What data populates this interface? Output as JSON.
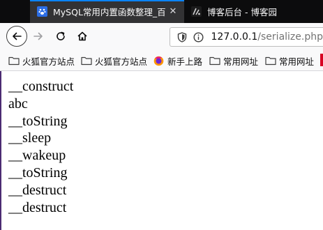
{
  "tabs": [
    {
      "title": "MySQL常用内置函数整理_百度",
      "favicon": "baidu-paw-icon",
      "active": true
    },
    {
      "title": "博客后台 - 博客园",
      "favicon": "cnblogs-icon",
      "active": false
    }
  ],
  "toolbar": {
    "back": "back-arrow-icon",
    "forward": "forward-arrow-icon",
    "reload": "reload-icon",
    "home": "home-icon"
  },
  "url": {
    "host": "127.0.0.1",
    "path": "/serialize.php"
  },
  "bookmarks": [
    {
      "label": "火狐官方站点",
      "icon": "folder-icon"
    },
    {
      "label": "火狐官方站点",
      "icon": "folder-icon"
    },
    {
      "label": "新手上路",
      "icon": "firefox-icon"
    },
    {
      "label": "常用网址",
      "icon": "folder-icon"
    },
    {
      "label": "常用网址",
      "icon": "folder-icon"
    }
  ],
  "output_lines": [
    "__construct",
    "abc",
    "__toString",
    "__sleep",
    "__wakeup",
    "__toString",
    "__destruct",
    "__destruct"
  ],
  "colors": {
    "tabbar_bg": "#0c0c0d",
    "active_tab_bg": "#323234",
    "accent": "#0a84ff",
    "toolbar_bg": "#f9f9fa"
  }
}
